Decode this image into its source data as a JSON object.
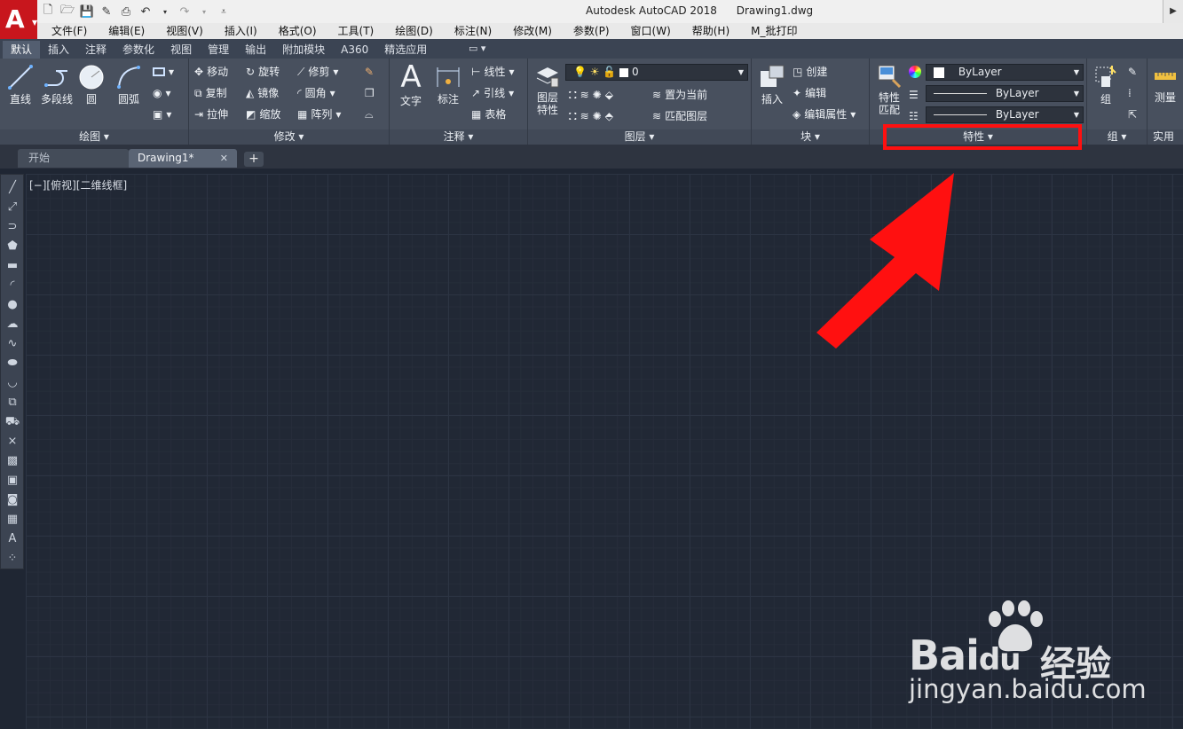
{
  "title_bar": {
    "app_name": "Autodesk AutoCAD 2018",
    "document": "Drawing1.dwg",
    "logo_letter": "A"
  },
  "menu": [
    "文件(F)",
    "编辑(E)",
    "视图(V)",
    "插入(I)",
    "格式(O)",
    "工具(T)",
    "绘图(D)",
    "标注(N)",
    "修改(M)",
    "参数(P)",
    "窗口(W)",
    "帮助(H)",
    "M_批打印"
  ],
  "ribbon_tabs": [
    "默认",
    "插入",
    "注释",
    "参数化",
    "视图",
    "管理",
    "输出",
    "附加模块",
    "A360",
    "精选应用"
  ],
  "panels": {
    "draw": {
      "title": "绘图 ▾",
      "line": "直线",
      "polyline": "多段线",
      "circle": "圆",
      "arc": "圆弧"
    },
    "modify": {
      "title": "修改 ▾",
      "move": "移动",
      "rotate": "旋转",
      "trim": "修剪",
      "copy": "复制",
      "mirror": "镜像",
      "fillet": "圆角",
      "stretch": "拉伸",
      "scale": "缩放",
      "array": "阵列"
    },
    "annotation": {
      "title": "注释 ▾",
      "text": "文字",
      "dimension": "标注",
      "linear": "线性",
      "leader": "引线",
      "table": "表格"
    },
    "layers": {
      "title": "图层 ▾",
      "layer_props_1": "图层",
      "layer_props_2": "特性",
      "current_layer": "0",
      "set_current": "置为当前",
      "match_layer": "匹配图层"
    },
    "block": {
      "title": "块 ▾",
      "insert": "插入",
      "create": "创建",
      "edit": "编辑",
      "edit_attr": "编辑属性"
    },
    "properties": {
      "title": "特性 ▾",
      "match_1": "特性",
      "match_2": "匹配",
      "color": "ByLayer",
      "lineweight": "ByLayer",
      "linetype": "ByLayer"
    },
    "groups": {
      "title": "组 ▾",
      "group": "组"
    },
    "utilities": {
      "title": "实用工",
      "measure": "测量"
    }
  },
  "file_tabs": {
    "start": "开始",
    "drawing": "Drawing1*",
    "plus": "+"
  },
  "viewport_label": "[−][俯视][二维线框]",
  "watermark": {
    "brand": "Bai",
    "brand2": "du",
    "cn": "经验",
    "url": "jingyan.baidu.com"
  },
  "colors": {
    "accent_red": "#ff1010",
    "canvas": "#212835",
    "ribbon": "#48505e"
  }
}
